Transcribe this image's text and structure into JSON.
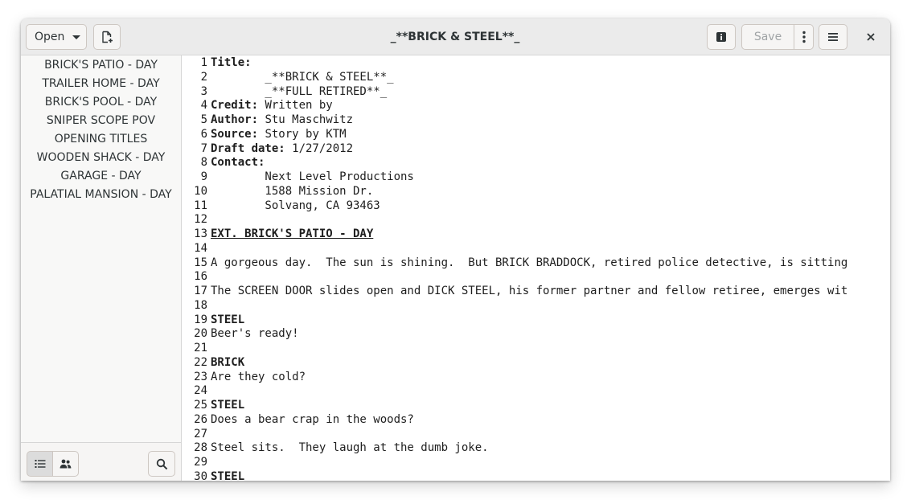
{
  "window": {
    "title": "_**BRICK & STEEL**_"
  },
  "toolbar": {
    "open_label": "Open",
    "save_label": "Save",
    "new_icon": "new-document-icon",
    "info_icon": "info-icon",
    "more_icon": "vertical-dots-icon",
    "menu_icon": "hamburger-menu-icon",
    "close_icon": "close-icon"
  },
  "sidebar": {
    "scenes": [
      "BRICK'S PATIO - DAY",
      "TRAILER HOME - DAY",
      "BRICK'S POOL - DAY",
      "SNIPER SCOPE POV",
      "OPENING TITLES",
      "WOODEN SHACK - DAY",
      "GARAGE - DAY",
      "PALATIAL MANSION - DAY"
    ],
    "footer_icons": [
      "list-icon",
      "characters-icon",
      "search-icon"
    ]
  },
  "editor": {
    "lines": [
      {
        "n": "1",
        "key": "Title:",
        "text": ""
      },
      {
        "n": "2",
        "key": "",
        "text": "        _**BRICK & STEEL**_"
      },
      {
        "n": "3",
        "key": "",
        "text": "        _**FULL RETIRED**_"
      },
      {
        "n": "4",
        "key": "Credit:",
        "text": " Written by"
      },
      {
        "n": "5",
        "key": "Author:",
        "text": " Stu Maschwitz"
      },
      {
        "n": "6",
        "key": "Source:",
        "text": " Story by KTM"
      },
      {
        "n": "7",
        "key": "Draft date:",
        "text": " 1/27/2012"
      },
      {
        "n": "8",
        "key": "Contact:",
        "text": ""
      },
      {
        "n": "9",
        "key": "",
        "text": "        Next Level Productions"
      },
      {
        "n": "10",
        "key": "",
        "text": "        1588 Mission Dr."
      },
      {
        "n": "11",
        "key": "",
        "text": "        Solvang, CA 93463"
      },
      {
        "n": "12",
        "key": "",
        "text": ""
      },
      {
        "n": "13",
        "style": "scene",
        "text": "EXT. BRICK'S PATIO - DAY"
      },
      {
        "n": "14",
        "key": "",
        "text": ""
      },
      {
        "n": "15",
        "key": "",
        "text": "A gorgeous day.  The sun is shining.  But BRICK BRADDOCK, retired police detective, is sitting"
      },
      {
        "n": "16",
        "key": "",
        "text": ""
      },
      {
        "n": "17",
        "key": "",
        "text": "The SCREEN DOOR slides open and DICK STEEL, his former partner and fellow retiree, emerges wit"
      },
      {
        "n": "18",
        "key": "",
        "text": ""
      },
      {
        "n": "19",
        "style": "bold",
        "text": "STEEL"
      },
      {
        "n": "20",
        "key": "",
        "text": "Beer's ready!"
      },
      {
        "n": "21",
        "key": "",
        "text": ""
      },
      {
        "n": "22",
        "style": "bold",
        "text": "BRICK"
      },
      {
        "n": "23",
        "key": "",
        "text": "Are they cold?"
      },
      {
        "n": "24",
        "key": "",
        "text": ""
      },
      {
        "n": "25",
        "style": "bold",
        "text": "STEEL"
      },
      {
        "n": "26",
        "key": "",
        "text": "Does a bear crap in the woods?"
      },
      {
        "n": "27",
        "key": "",
        "text": ""
      },
      {
        "n": "28",
        "key": "",
        "text": "Steel sits.  They laugh at the dumb joke."
      },
      {
        "n": "29",
        "key": "",
        "text": ""
      },
      {
        "n": "30",
        "style": "bold",
        "text": "STEEL"
      }
    ]
  }
}
